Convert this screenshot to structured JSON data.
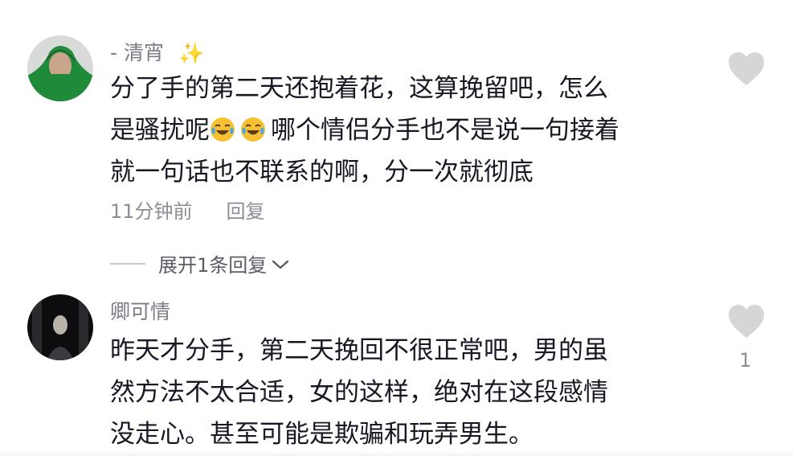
{
  "comments": [
    {
      "username": "- 清宵",
      "text_lines": [
        "分了手的第二天还抱着花，这算挽留吧，怎么",
        "是骚扰呢",
        "哪个情侣分手也不是说一句接着",
        "就一句话也不联系的啊，分一次就彻底"
      ],
      "time": "11分钟前",
      "reply_label": "回复",
      "expand_label": "展开1条回复"
    },
    {
      "username": "卿可情",
      "text_lines": [
        "昨天才分手，第二天挽回不很正常吧，男的虽",
        "然方法不太合适，女的这样，绝对在这段感情",
        "没走心。甚至可能是欺骗和玩弄男生。"
      ],
      "like_count": "1"
    }
  ],
  "icons": {
    "sparkle": "sparkles-icon",
    "emoji": "crying-laughing-emoji",
    "like": "heart-icon",
    "expand": "chevron-down-icon"
  },
  "colors": {
    "username": "#7a7d85",
    "meta": "#8a8d95",
    "heart": "#d6d6d8"
  }
}
